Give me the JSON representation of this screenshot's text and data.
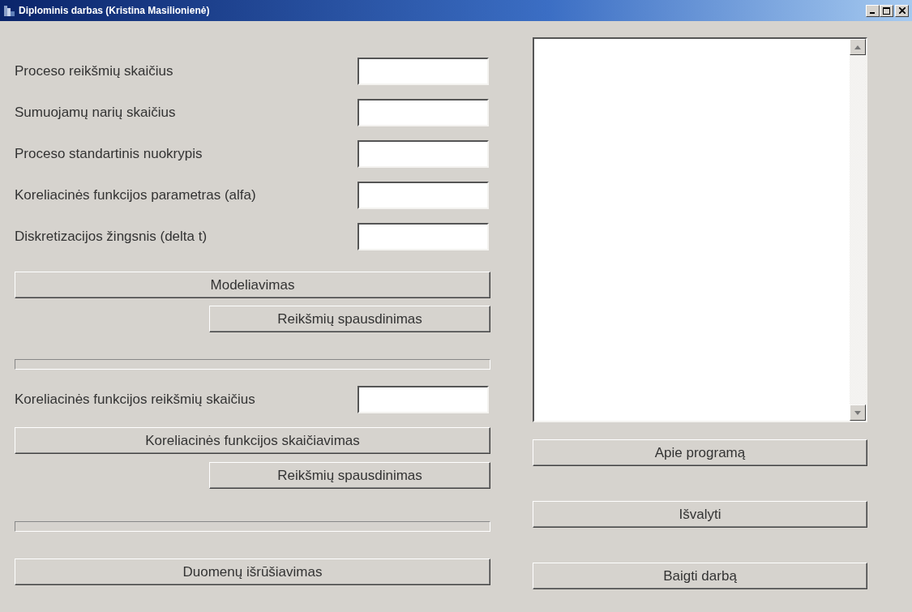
{
  "window": {
    "title": "Diplominis darbas (Kristina Masilionienė)"
  },
  "process_fields": [
    {
      "label": "Proceso reikšmių skaičius"
    },
    {
      "label": "Sumuojamų narių skaičius"
    },
    {
      "label": "Proceso standartinis nuokrypis"
    },
    {
      "label": "Koreliacinės funkcijos parametras (alfa)"
    },
    {
      "label": "Diskretizacijos žingsnis (delta t)"
    }
  ],
  "model_button": "Modeliavimas",
  "model_print_button": "Reikšmių spausdinimas",
  "model_progress": {
    "level": 0
  },
  "correlation_field": {
    "label": "Koreliacinės funkcijos reikšmių skaičius"
  },
  "correlation_button": "Koreliacinės funkcijos skaičiavimas",
  "correlation_print_button": "Reikšmių spausdinimas",
  "correlation_progress": {
    "level": 0
  },
  "sort_button": "Duomenų išrūšiavimas",
  "right_buttons": [
    "Apie programą",
    "Išvalyti",
    "Baigti darbą"
  ]
}
